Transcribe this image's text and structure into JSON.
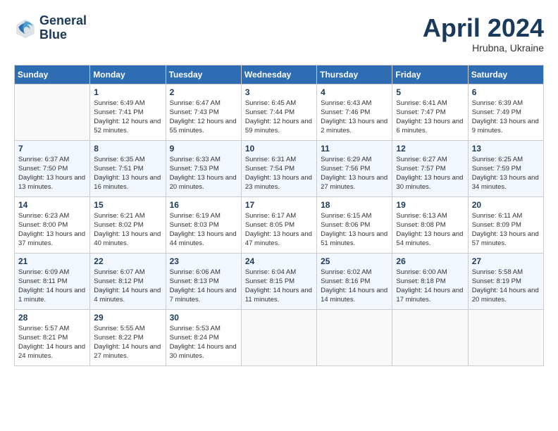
{
  "header": {
    "logo_line1": "General",
    "logo_line2": "Blue",
    "month_year": "April 2024",
    "location": "Hrubna, Ukraine"
  },
  "weekdays": [
    "Sunday",
    "Monday",
    "Tuesday",
    "Wednesday",
    "Thursday",
    "Friday",
    "Saturday"
  ],
  "weeks": [
    [
      {
        "day": "",
        "empty": true
      },
      {
        "day": "1",
        "sunrise": "Sunrise: 6:49 AM",
        "sunset": "Sunset: 7:41 PM",
        "daylight": "Daylight: 12 hours and 52 minutes."
      },
      {
        "day": "2",
        "sunrise": "Sunrise: 6:47 AM",
        "sunset": "Sunset: 7:43 PM",
        "daylight": "Daylight: 12 hours and 55 minutes."
      },
      {
        "day": "3",
        "sunrise": "Sunrise: 6:45 AM",
        "sunset": "Sunset: 7:44 PM",
        "daylight": "Daylight: 12 hours and 59 minutes."
      },
      {
        "day": "4",
        "sunrise": "Sunrise: 6:43 AM",
        "sunset": "Sunset: 7:46 PM",
        "daylight": "Daylight: 13 hours and 2 minutes."
      },
      {
        "day": "5",
        "sunrise": "Sunrise: 6:41 AM",
        "sunset": "Sunset: 7:47 PM",
        "daylight": "Daylight: 13 hours and 6 minutes."
      },
      {
        "day": "6",
        "sunrise": "Sunrise: 6:39 AM",
        "sunset": "Sunset: 7:49 PM",
        "daylight": "Daylight: 13 hours and 9 minutes."
      }
    ],
    [
      {
        "day": "7",
        "sunrise": "Sunrise: 6:37 AM",
        "sunset": "Sunset: 7:50 PM",
        "daylight": "Daylight: 13 hours and 13 minutes."
      },
      {
        "day": "8",
        "sunrise": "Sunrise: 6:35 AM",
        "sunset": "Sunset: 7:51 PM",
        "daylight": "Daylight: 13 hours and 16 minutes."
      },
      {
        "day": "9",
        "sunrise": "Sunrise: 6:33 AM",
        "sunset": "Sunset: 7:53 PM",
        "daylight": "Daylight: 13 hours and 20 minutes."
      },
      {
        "day": "10",
        "sunrise": "Sunrise: 6:31 AM",
        "sunset": "Sunset: 7:54 PM",
        "daylight": "Daylight: 13 hours and 23 minutes."
      },
      {
        "day": "11",
        "sunrise": "Sunrise: 6:29 AM",
        "sunset": "Sunset: 7:56 PM",
        "daylight": "Daylight: 13 hours and 27 minutes."
      },
      {
        "day": "12",
        "sunrise": "Sunrise: 6:27 AM",
        "sunset": "Sunset: 7:57 PM",
        "daylight": "Daylight: 13 hours and 30 minutes."
      },
      {
        "day": "13",
        "sunrise": "Sunrise: 6:25 AM",
        "sunset": "Sunset: 7:59 PM",
        "daylight": "Daylight: 13 hours and 34 minutes."
      }
    ],
    [
      {
        "day": "14",
        "sunrise": "Sunrise: 6:23 AM",
        "sunset": "Sunset: 8:00 PM",
        "daylight": "Daylight: 13 hours and 37 minutes."
      },
      {
        "day": "15",
        "sunrise": "Sunrise: 6:21 AM",
        "sunset": "Sunset: 8:02 PM",
        "daylight": "Daylight: 13 hours and 40 minutes."
      },
      {
        "day": "16",
        "sunrise": "Sunrise: 6:19 AM",
        "sunset": "Sunset: 8:03 PM",
        "daylight": "Daylight: 13 hours and 44 minutes."
      },
      {
        "day": "17",
        "sunrise": "Sunrise: 6:17 AM",
        "sunset": "Sunset: 8:05 PM",
        "daylight": "Daylight: 13 hours and 47 minutes."
      },
      {
        "day": "18",
        "sunrise": "Sunrise: 6:15 AM",
        "sunset": "Sunset: 8:06 PM",
        "daylight": "Daylight: 13 hours and 51 minutes."
      },
      {
        "day": "19",
        "sunrise": "Sunrise: 6:13 AM",
        "sunset": "Sunset: 8:08 PM",
        "daylight": "Daylight: 13 hours and 54 minutes."
      },
      {
        "day": "20",
        "sunrise": "Sunrise: 6:11 AM",
        "sunset": "Sunset: 8:09 PM",
        "daylight": "Daylight: 13 hours and 57 minutes."
      }
    ],
    [
      {
        "day": "21",
        "sunrise": "Sunrise: 6:09 AM",
        "sunset": "Sunset: 8:11 PM",
        "daylight": "Daylight: 14 hours and 1 minute."
      },
      {
        "day": "22",
        "sunrise": "Sunrise: 6:07 AM",
        "sunset": "Sunset: 8:12 PM",
        "daylight": "Daylight: 14 hours and 4 minutes."
      },
      {
        "day": "23",
        "sunrise": "Sunrise: 6:06 AM",
        "sunset": "Sunset: 8:13 PM",
        "daylight": "Daylight: 14 hours and 7 minutes."
      },
      {
        "day": "24",
        "sunrise": "Sunrise: 6:04 AM",
        "sunset": "Sunset: 8:15 PM",
        "daylight": "Daylight: 14 hours and 11 minutes."
      },
      {
        "day": "25",
        "sunrise": "Sunrise: 6:02 AM",
        "sunset": "Sunset: 8:16 PM",
        "daylight": "Daylight: 14 hours and 14 minutes."
      },
      {
        "day": "26",
        "sunrise": "Sunrise: 6:00 AM",
        "sunset": "Sunset: 8:18 PM",
        "daylight": "Daylight: 14 hours and 17 minutes."
      },
      {
        "day": "27",
        "sunrise": "Sunrise: 5:58 AM",
        "sunset": "Sunset: 8:19 PM",
        "daylight": "Daylight: 14 hours and 20 minutes."
      }
    ],
    [
      {
        "day": "28",
        "sunrise": "Sunrise: 5:57 AM",
        "sunset": "Sunset: 8:21 PM",
        "daylight": "Daylight: 14 hours and 24 minutes."
      },
      {
        "day": "29",
        "sunrise": "Sunrise: 5:55 AM",
        "sunset": "Sunset: 8:22 PM",
        "daylight": "Daylight: 14 hours and 27 minutes."
      },
      {
        "day": "30",
        "sunrise": "Sunrise: 5:53 AM",
        "sunset": "Sunset: 8:24 PM",
        "daylight": "Daylight: 14 hours and 30 minutes."
      },
      {
        "day": "",
        "empty": true
      },
      {
        "day": "",
        "empty": true
      },
      {
        "day": "",
        "empty": true
      },
      {
        "day": "",
        "empty": true
      }
    ]
  ]
}
